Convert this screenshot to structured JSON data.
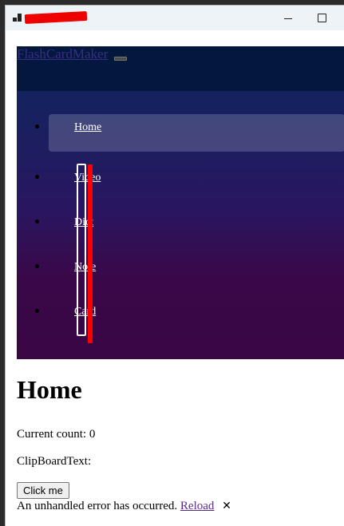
{
  "window": {
    "title": "",
    "icon": "app-window-icon",
    "controls": [
      "minimize-icon",
      "maximize-icon"
    ]
  },
  "navbar": {
    "brand": "FlashCardMaker",
    "toggler_icon": "hamburger-icon"
  },
  "sidebar": {
    "items": [
      {
        "label": "Home",
        "active": true
      },
      {
        "label": "Video",
        "active": false
      },
      {
        "label": "Dict",
        "active": false
      },
      {
        "label": "Note",
        "active": false
      },
      {
        "label": "Card",
        "active": false
      }
    ]
  },
  "main": {
    "heading": "Home",
    "count_text": "Current count: 0",
    "clipboard_text": "ClipBoardText:",
    "button_label": "Click me"
  },
  "error_bar": {
    "message": "An unhandled error has occurred.",
    "reload_label": "Reload",
    "dismiss_glyph": "✕"
  },
  "colors": {
    "navbar_bg": "#04173c",
    "sidebar_gradient_top": "#13235f",
    "sidebar_gradient_bottom": "#3a0644",
    "annotation_red": "#ff0000"
  }
}
